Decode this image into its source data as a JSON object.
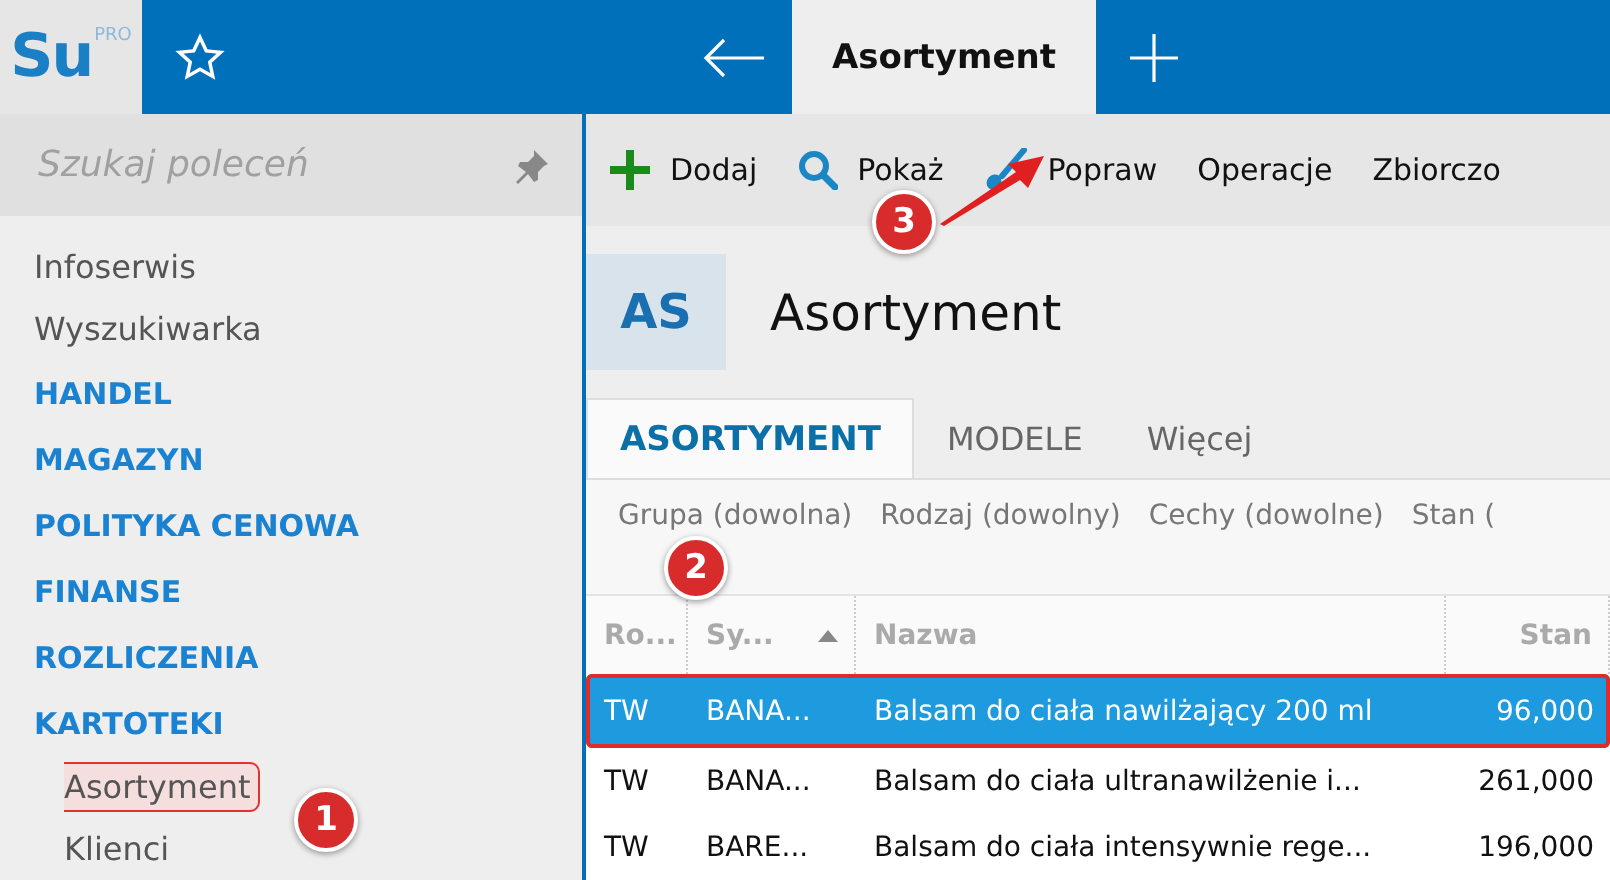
{
  "logo": {
    "text": "Su",
    "badge": "PRO"
  },
  "top_tabs": [
    {
      "label": "Asortyment",
      "selected": true
    }
  ],
  "search": {
    "placeholder": "Szukaj poleceń"
  },
  "sidebar": {
    "items": [
      {
        "label": "Infoserwis",
        "kind": "link",
        "selected": false
      },
      {
        "label": "Wyszukiwarka",
        "kind": "link",
        "selected": false
      },
      {
        "label": "HANDEL",
        "kind": "section",
        "selected": false
      },
      {
        "label": "MAGAZYN",
        "kind": "section",
        "selected": false
      },
      {
        "label": "POLITYKA CENOWA",
        "kind": "section",
        "selected": false
      },
      {
        "label": "FINANSE",
        "kind": "section",
        "selected": false
      },
      {
        "label": "ROZLICZENIA",
        "kind": "section",
        "selected": false
      },
      {
        "label": "KARTOTEKI",
        "kind": "section",
        "selected": false,
        "children": [
          {
            "label": "Asortyment",
            "kind": "link",
            "selected": true
          },
          {
            "label": "Klienci",
            "kind": "link",
            "selected": false
          }
        ]
      }
    ]
  },
  "toolbar": [
    {
      "label": "Dodaj",
      "kind": "plus"
    },
    {
      "label": "Pokaż",
      "kind": "search"
    },
    {
      "label": "Popraw",
      "kind": "brush"
    },
    {
      "label": "Operacje",
      "kind": "text"
    },
    {
      "label": "Zbiorczo",
      "kind": "text"
    }
  ],
  "header": {
    "badge": "AS",
    "title": "Asortyment"
  },
  "tabs": [
    {
      "label": "ASORTYMENT",
      "selected": true
    },
    {
      "label": "MODELE",
      "selected": false
    },
    {
      "label": "Więcej",
      "selected": false
    }
  ],
  "filters": [
    "Grupa (dowolna)",
    "Rodzaj (dowolny)",
    "Cechy (dowolne)",
    "Stan ("
  ],
  "table": {
    "columns": [
      {
        "label": "Ro...",
        "sorted": false
      },
      {
        "label": "Sy...",
        "sorted": true
      },
      {
        "label": "Nazwa",
        "sorted": false
      },
      {
        "label": "Stan",
        "sorted": false
      }
    ],
    "rows": [
      {
        "cells": [
          "TW",
          "BANA...",
          "Balsam do ciała nawilżający 200 ml",
          "96,000"
        ],
        "selected": true
      },
      {
        "cells": [
          "TW",
          "BANA...",
          "Balsam do ciała ultranawilżenie i...",
          "261,000"
        ],
        "selected": false
      },
      {
        "cells": [
          "TW",
          "BARE...",
          "Balsam do ciała intensywnie rege...",
          "196,000"
        ],
        "selected": false
      }
    ]
  },
  "callouts": [
    "1",
    "2",
    "3"
  ]
}
